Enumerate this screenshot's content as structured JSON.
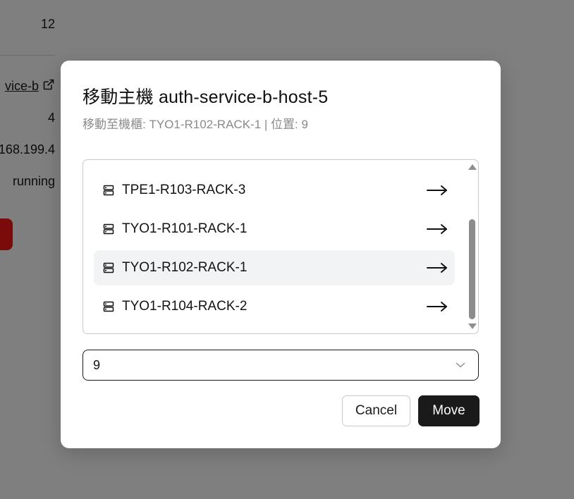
{
  "background": {
    "count": "12",
    "service_link": "vice-b",
    "number": "4",
    "ip": "168.199.4",
    "status": "running"
  },
  "modal": {
    "title": "移動主機 auth-service-b-host-5",
    "subtitle": "移動至機櫃: TYO1-R102-RACK-1 | 位置: 9",
    "racks": [
      {
        "label": "TPE1-R103-RACK-3",
        "icon": "server-icon",
        "selected": false
      },
      {
        "label": "TYO1-R101-RACK-1",
        "icon": "server-icon",
        "selected": false
      },
      {
        "label": "TYO1-R102-RACK-1",
        "icon": "server-icon",
        "selected": true
      },
      {
        "label": "TYO1-R104-RACK-2",
        "icon": "server-icon",
        "selected": false
      }
    ],
    "position_select": {
      "value": "9"
    },
    "buttons": {
      "cancel": "Cancel",
      "move": "Move"
    }
  },
  "colors": {
    "overlay": "#7f7f7f",
    "primary_button": "#1a1a1a",
    "selected_row": "#f2f3f5",
    "danger_button": "#7b0a0a",
    "muted_text": "#8a8a8a"
  }
}
